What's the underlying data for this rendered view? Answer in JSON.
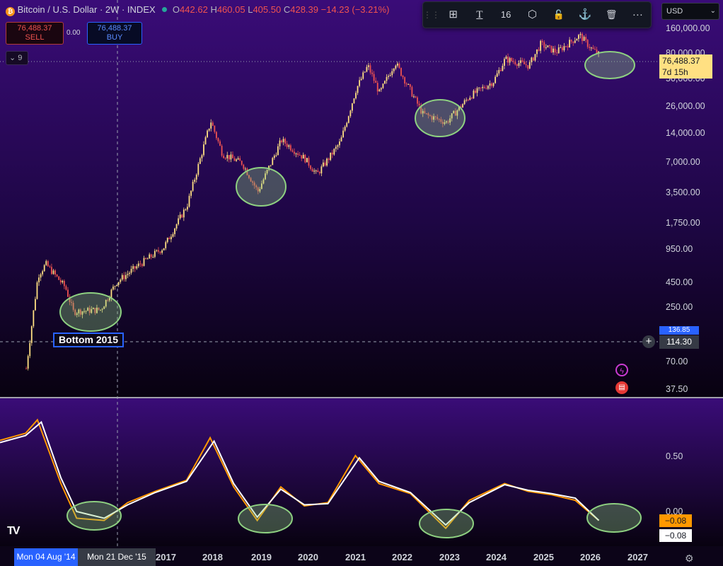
{
  "header": {
    "symbol": "Bitcoin / U.S. Dollar · 2W · INDEX",
    "open_label": "O",
    "open": "442.62",
    "high_label": "H",
    "high": "460.05",
    "low_label": "L",
    "low": "405.50",
    "close_label": "C",
    "close": "428.39",
    "change": "−14.23 (−3.21%)"
  },
  "trade": {
    "sell_price": "76,488.37",
    "sell_label": "SELL",
    "spread": "0.00",
    "buy_price": "76,488.37",
    "buy_label": "BUY"
  },
  "indicator_toggle": "9",
  "toolbar": {
    "items": [
      {
        "icon": "add-template-icon",
        "glyph": "⊞"
      },
      {
        "icon": "text-tool-icon",
        "glyph": "T"
      },
      {
        "icon": "font-size",
        "glyph": "16"
      },
      {
        "icon": "settings-hex-icon",
        "glyph": "⬡"
      },
      {
        "icon": "lock-icon",
        "glyph": "🔓"
      },
      {
        "icon": "anchor-icon",
        "glyph": "⚓"
      },
      {
        "icon": "trash-icon",
        "glyph": "🗑"
      },
      {
        "icon": "more-icon",
        "glyph": "···"
      }
    ]
  },
  "currency": "USD",
  "price_axis": {
    "labels": [
      "160,000.00",
      "80,000.00",
      "50,000.00",
      "26,000.00",
      "14,000.00",
      "7,000.00",
      "3,500.00",
      "1,750.00",
      "950.00",
      "450.00",
      "250.00",
      "70.00",
      "37.50"
    ]
  },
  "last_price": {
    "value": "76,488.37",
    "countdown": "7d 15h"
  },
  "crosshair_price": "114.30",
  "hidden_tag": "136.85",
  "oscillator_axis": {
    "labels": [
      "0.50",
      "0.00"
    ]
  },
  "oscillator_tags": {
    "orange": "−0.08",
    "white": "−0.08"
  },
  "drawing_label": "Bottom 2015",
  "time_axis": {
    "labels": [
      "2017",
      "2018",
      "2019",
      "2020",
      "2021",
      "2022",
      "2023",
      "2024",
      "2025",
      "2026",
      "2027"
    ],
    "crosshair_start": "Mon 04 Aug '14",
    "crosshair_end": "Mon 21 Dec '15"
  },
  "logo": "TV",
  "colors": {
    "up_candle": "#ffe082",
    "down_candle": "#ef5350",
    "oscillator_fast": "#ff9800",
    "oscillator_slow": "#ffffff",
    "highlight_ellipse": "#8ed081",
    "background_top": "#3a0c78",
    "background_bottom": "#080210"
  },
  "chart_data": {
    "type": "candlestick",
    "scale": "log",
    "price_pane": {
      "series_approx_close": [
        {
          "date": "2014-01",
          "value": 60
        },
        {
          "date": "2014-04",
          "value": 500
        },
        {
          "date": "2014-06",
          "value": 650
        },
        {
          "date": "2014-11",
          "value": 380
        },
        {
          "date": "2015-01",
          "value": 220
        },
        {
          "date": "2015-08",
          "value": 230
        },
        {
          "date": "2015-12",
          "value": 430
        },
        {
          "date": "2016-06",
          "value": 650
        },
        {
          "date": "2016-12",
          "value": 950
        },
        {
          "date": "2017-06",
          "value": 2500
        },
        {
          "date": "2017-12",
          "value": 17000
        },
        {
          "date": "2018-03",
          "value": 8000
        },
        {
          "date": "2018-08",
          "value": 6500
        },
        {
          "date": "2018-12",
          "value": 3400
        },
        {
          "date": "2019-06",
          "value": 11000
        },
        {
          "date": "2019-12",
          "value": 7200
        },
        {
          "date": "2020-03",
          "value": 5000
        },
        {
          "date": "2020-09",
          "value": 10500
        },
        {
          "date": "2021-01",
          "value": 35000
        },
        {
          "date": "2021-04",
          "value": 60000
        },
        {
          "date": "2021-07",
          "value": 32000
        },
        {
          "date": "2021-11",
          "value": 65000
        },
        {
          "date": "2022-06",
          "value": 20000
        },
        {
          "date": "2022-12",
          "value": 16500
        },
        {
          "date": "2023-06",
          "value": 30000
        },
        {
          "date": "2023-12",
          "value": 42000
        },
        {
          "date": "2024-03",
          "value": 70000
        },
        {
          "date": "2024-09",
          "value": 60000
        },
        {
          "date": "2024-12",
          "value": 98000
        },
        {
          "date": "2025-04",
          "value": 82000
        },
        {
          "date": "2025-10",
          "value": 120000
        },
        {
          "date": "2026-01",
          "value": 88000
        },
        {
          "date": "2026-03",
          "value": 76488
        }
      ]
    },
    "oscillator_pane": {
      "series": [
        {
          "name": "",
          "color": "#ff9800",
          "values": [
            {
              "date": "2014-01",
              "value": 0.7
            },
            {
              "date": "2014-04",
              "value": 0.82
            },
            {
              "date": "2014-10",
              "value": 0.25
            },
            {
              "date": "2015-02",
              "value": -0.06
            },
            {
              "date": "2015-09",
              "value": -0.08
            },
            {
              "date": "2016-03",
              "value": 0.08
            },
            {
              "date": "2016-10",
              "value": 0.18
            },
            {
              "date": "2017-06",
              "value": 0.28
            },
            {
              "date": "2017-12",
              "value": 0.66
            },
            {
              "date": "2018-06",
              "value": 0.22
            },
            {
              "date": "2018-12",
              "value": -0.08
            },
            {
              "date": "2019-06",
              "value": 0.22
            },
            {
              "date": "2019-12",
              "value": 0.05
            },
            {
              "date": "2020-06",
              "value": 0.08
            },
            {
              "date": "2021-01",
              "value": 0.5
            },
            {
              "date": "2021-07",
              "value": 0.25
            },
            {
              "date": "2022-03",
              "value": 0.16
            },
            {
              "date": "2022-12",
              "value": -0.15
            },
            {
              "date": "2023-06",
              "value": 0.1
            },
            {
              "date": "2024-03",
              "value": 0.25
            },
            {
              "date": "2024-09",
              "value": 0.18
            },
            {
              "date": "2025-03",
              "value": 0.15
            },
            {
              "date": "2025-09",
              "value": 0.1
            },
            {
              "date": "2026-03",
              "value": -0.08
            }
          ]
        },
        {
          "name": "",
          "color": "#ffffff",
          "values": [
            {
              "date": "2014-01",
              "value": 0.68
            },
            {
              "date": "2014-05",
              "value": 0.8
            },
            {
              "date": "2014-10",
              "value": 0.3
            },
            {
              "date": "2015-02",
              "value": 0.0
            },
            {
              "date": "2015-09",
              "value": -0.06
            },
            {
              "date": "2016-03",
              "value": 0.06
            },
            {
              "date": "2016-10",
              "value": 0.17
            },
            {
              "date": "2017-06",
              "value": 0.27
            },
            {
              "date": "2018-01",
              "value": 0.63
            },
            {
              "date": "2018-06",
              "value": 0.25
            },
            {
              "date": "2018-12",
              "value": -0.05
            },
            {
              "date": "2019-06",
              "value": 0.2
            },
            {
              "date": "2019-12",
              "value": 0.06
            },
            {
              "date": "2020-06",
              "value": 0.07
            },
            {
              "date": "2021-02",
              "value": 0.48
            },
            {
              "date": "2021-07",
              "value": 0.27
            },
            {
              "date": "2022-03",
              "value": 0.17
            },
            {
              "date": "2022-12",
              "value": -0.12
            },
            {
              "date": "2023-06",
              "value": 0.08
            },
            {
              "date": "2024-03",
              "value": 0.24
            },
            {
              "date": "2024-09",
              "value": 0.19
            },
            {
              "date": "2025-03",
              "value": 0.16
            },
            {
              "date": "2025-09",
              "value": 0.12
            },
            {
              "date": "2026-03",
              "value": -0.08
            }
          ]
        }
      ]
    },
    "highlighted_zones": [
      "2015",
      "2018-2019",
      "2022-2023",
      "2026"
    ]
  }
}
